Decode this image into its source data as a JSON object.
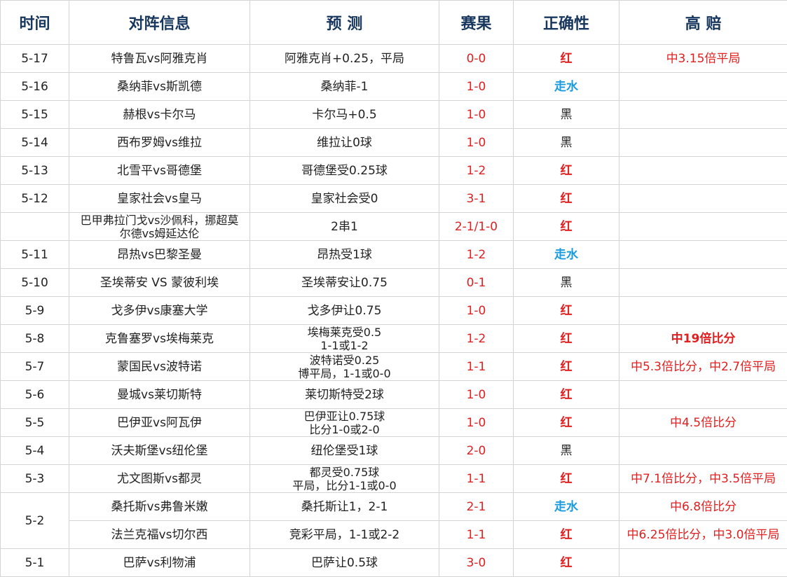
{
  "headers": [
    "时间",
    "对阵信息",
    "预  测",
    "赛果",
    "正确性",
    "高  赔"
  ],
  "rows": [
    {
      "date": "5-17",
      "match": "特鲁瓦vs阿雅克肖",
      "prediction": "阿雅克肖+0.25，平局",
      "score": "0-0",
      "result": "红",
      "result_type": "red",
      "odds": "中3.15倍平局"
    },
    {
      "date": "5-16",
      "match": "桑纳菲vs斯凯德",
      "prediction": "桑纳菲-1",
      "score": "1-0",
      "result": "走水",
      "result_type": "push",
      "odds": ""
    },
    {
      "date": "5-15",
      "match": "赫根vs卡尔马",
      "prediction": "卡尔马+0.5",
      "score": "1-0",
      "result": "黑",
      "result_type": "black",
      "odds": ""
    },
    {
      "date": "5-14",
      "match": "西布罗姆vs维拉",
      "prediction": "维拉让0球",
      "score": "1-0",
      "result": "黑",
      "result_type": "black",
      "odds": ""
    },
    {
      "date": "5-13",
      "match": "北雪平vs哥德堡",
      "prediction": "哥德堡受0.25球",
      "score": "1-2",
      "result": "红",
      "result_type": "red",
      "odds": ""
    },
    {
      "date": "5-12",
      "match": "皇家社会vs皇马",
      "prediction": "皇家社会受0",
      "score": "3-1",
      "result": "红",
      "result_type": "red",
      "odds": ""
    },
    {
      "date": "",
      "match_lines": [
        "巴甲弗拉门戈vs沙佩科，挪超莫",
        "尔德vs姆延达伦"
      ],
      "prediction": "2串1",
      "score": "2-1/1-0",
      "result": "红",
      "result_type": "red",
      "odds": ""
    },
    {
      "date": "5-11",
      "match": "昂热vs巴黎圣曼",
      "prediction": "昂热受1球",
      "score": "1-2",
      "result": "走水",
      "result_type": "push",
      "odds": ""
    },
    {
      "date": "5-10",
      "match": "圣埃蒂安 VS 蒙彼利埃",
      "prediction": "圣埃蒂安让0.75",
      "score": "0-1",
      "result": "黑",
      "result_type": "black",
      "odds": ""
    },
    {
      "date": "5-9",
      "match": "戈多伊vs康塞大学",
      "prediction": "戈多伊让0.75",
      "score": "1-0",
      "result": "红",
      "result_type": "red",
      "odds": ""
    },
    {
      "date": "5-8",
      "match": "克鲁塞罗vs埃梅莱克",
      "prediction_lines": [
        "埃梅莱克受0.5",
        "1-1或1-2"
      ],
      "score": "1-2",
      "result": "红",
      "result_type": "red",
      "odds": "中19倍比分",
      "odds_bold": true
    },
    {
      "date": "5-7",
      "match": "蒙国民vs波特诺",
      "prediction_lines": [
        "波特诺受0.25",
        "博平局，1-1或0-0"
      ],
      "score": "1-1",
      "result": "红",
      "result_type": "red",
      "odds": "中5.3倍比分，中2.7倍平局"
    },
    {
      "date": "5-6",
      "match": "曼城vs莱切斯特",
      "prediction": "莱切斯特受2球",
      "score": "1-0",
      "result": "红",
      "result_type": "red",
      "odds": ""
    },
    {
      "date": "5-5",
      "match": "巴伊亚vs阿瓦伊",
      "prediction_lines": [
        "巴伊亚让0.75球",
        "比分1-0或2-0"
      ],
      "score": "1-0",
      "result": "红",
      "result_type": "red",
      "odds": "中4.5倍比分"
    },
    {
      "date": "5-4",
      "match": "沃夫斯堡vs纽伦堡",
      "prediction": "纽伦堡受1球",
      "score": "2-0",
      "result": "黑",
      "result_type": "black",
      "odds": ""
    },
    {
      "date": "5-3",
      "match": "尤文图斯vs都灵",
      "prediction_lines": [
        "都灵受0.75球",
        "平局，比分1-1或0-0"
      ],
      "score": "1-1",
      "result": "红",
      "result_type": "red",
      "odds": "中7.1倍比分，中3.5倍平局"
    },
    {
      "date": "5-2",
      "match": "桑托斯vs弗鲁米嫩",
      "prediction": "桑托斯让1，2-1",
      "score": "2-1",
      "result": "走水",
      "result_type": "push",
      "odds": "中6.8倍比分",
      "date_rowspan": 2
    },
    {
      "date_merged": true,
      "match": "法兰克福vs切尔西",
      "prediction": "竞彩平局，1-1或2-2",
      "score": "1-1",
      "result": "红",
      "result_type": "red",
      "odds": "中6.25倍比分，中3.0倍平局"
    },
    {
      "date": "5-1",
      "match": "巴萨vs利物浦",
      "prediction": "巴萨让0.5球",
      "score": "3-0",
      "result": "红",
      "result_type": "red",
      "odds": ""
    }
  ]
}
